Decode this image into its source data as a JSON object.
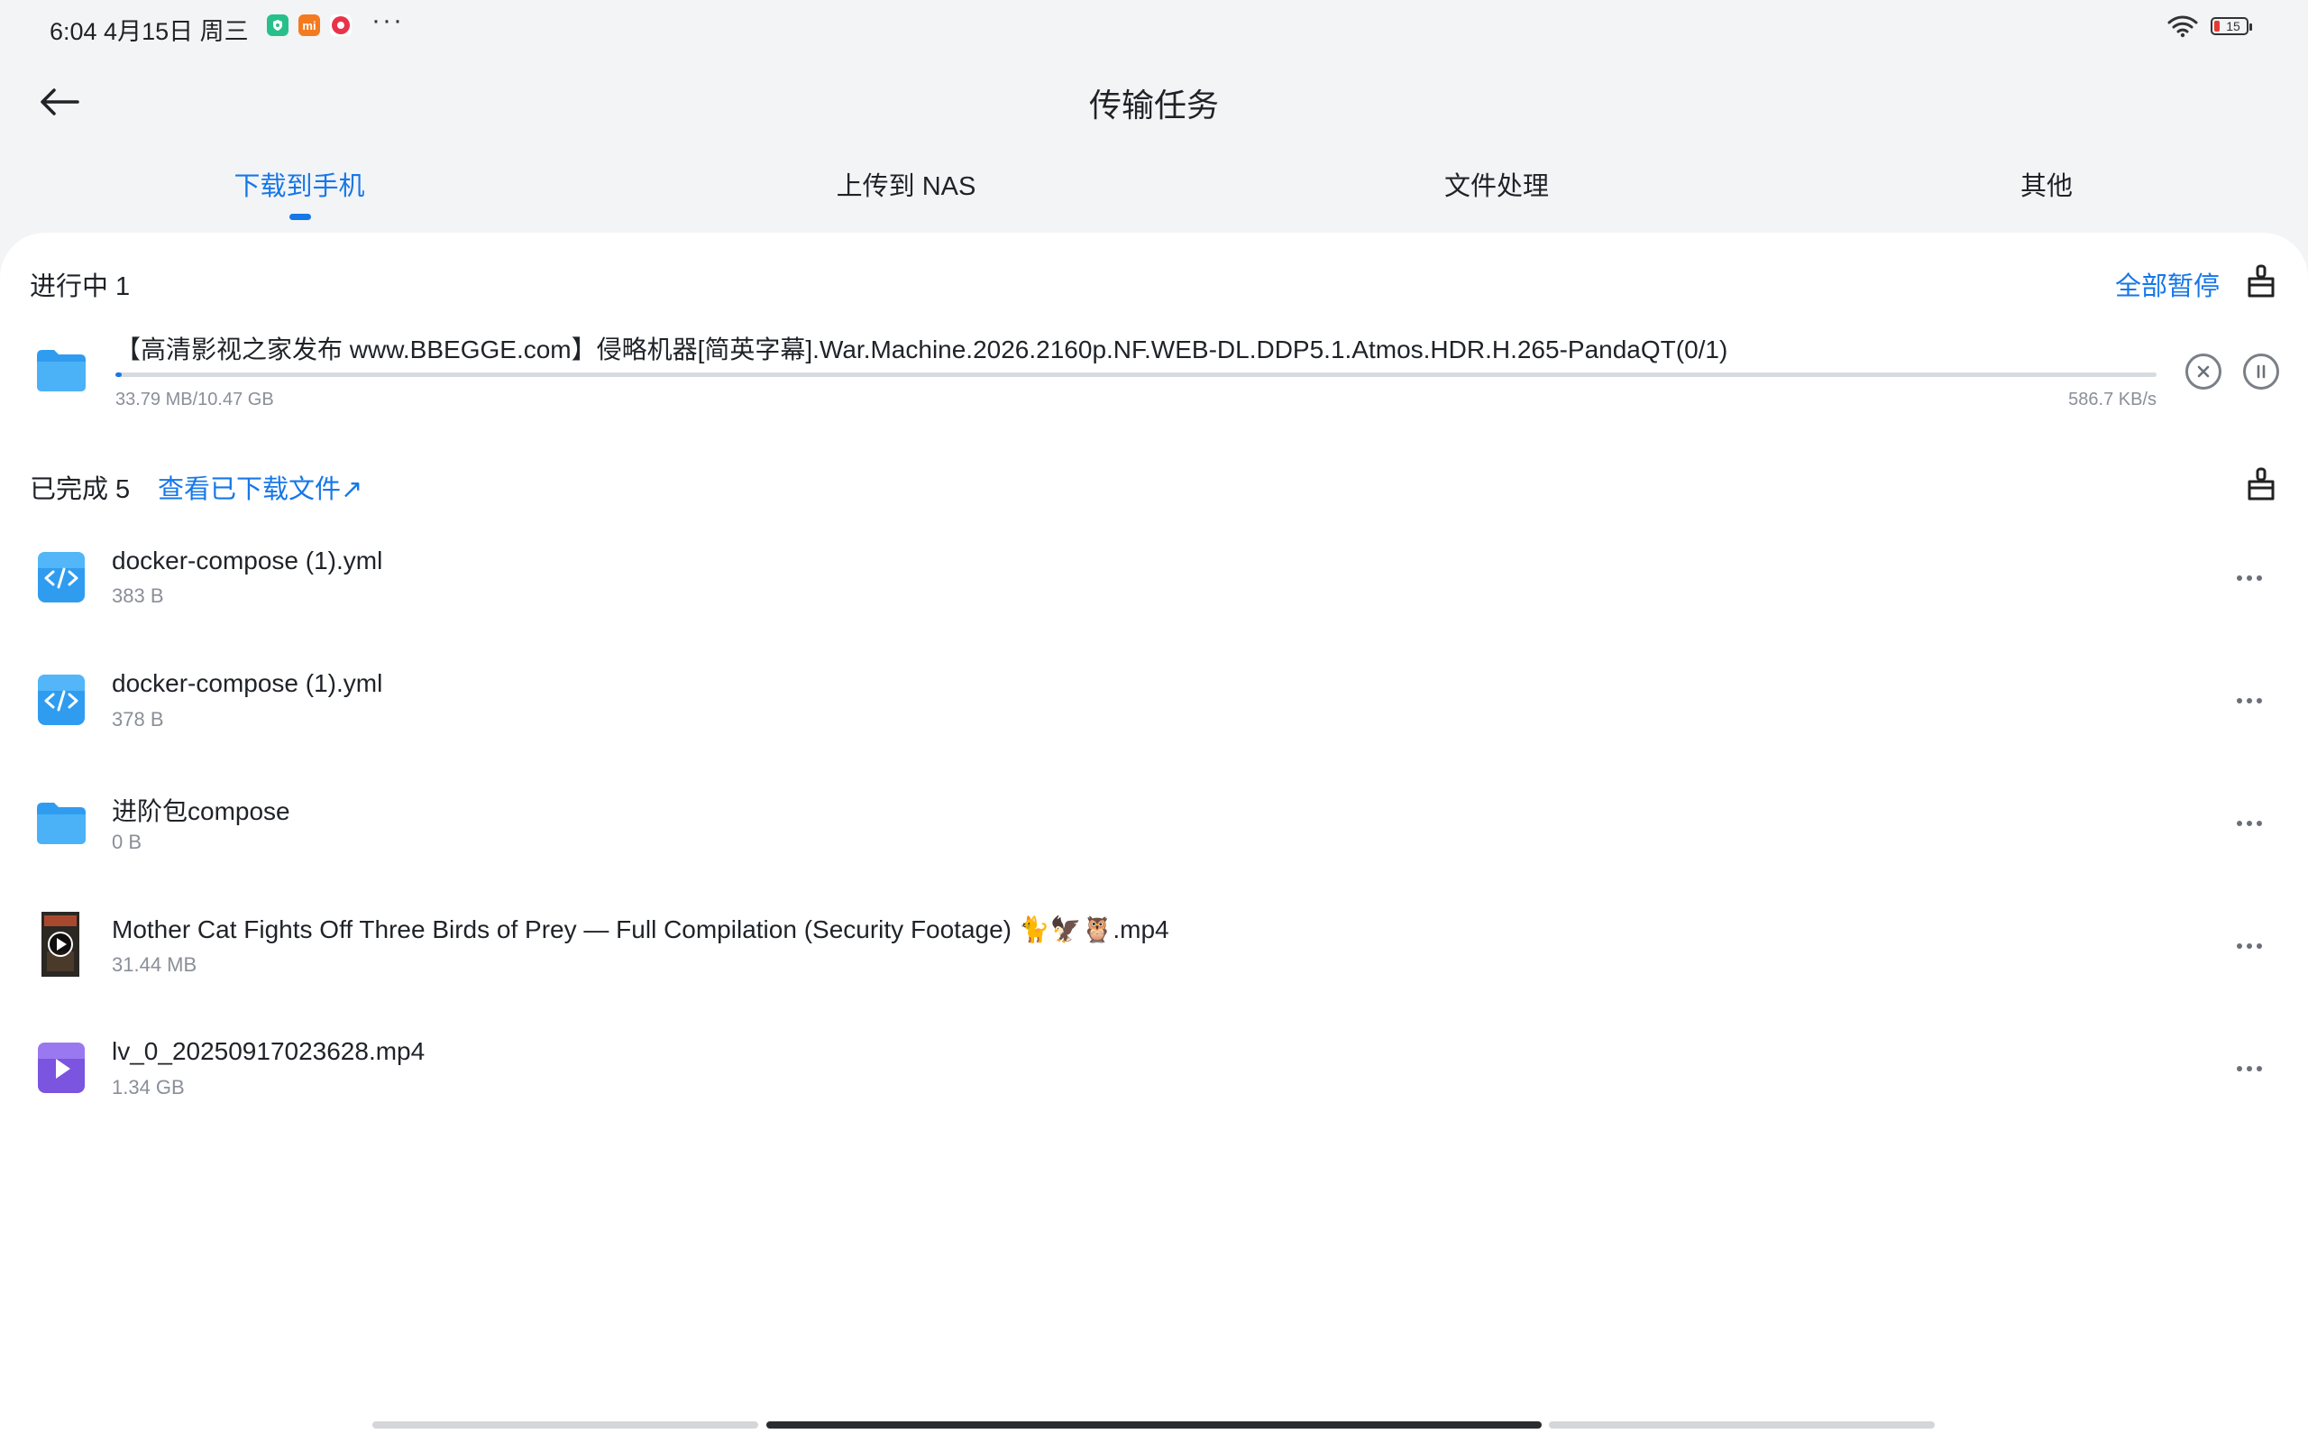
{
  "status_bar": {
    "time": "6:04 4月15日 周三",
    "more": "···",
    "battery": "15",
    "icons": [
      "shield-app-icon",
      "mi-app-icon",
      "recorder-app-icon",
      "wifi-icon",
      "battery-icon"
    ]
  },
  "header": {
    "title": "传输任务"
  },
  "tabs": [
    {
      "label": "下载到手机",
      "active": true
    },
    {
      "label": "上传到 NAS"
    },
    {
      "label": "文件处理"
    },
    {
      "label": "其他"
    }
  ],
  "in_progress": {
    "title": "进行中 1",
    "pause_all": "全部暂停",
    "task": {
      "name": "【高清影视之家发布 www.BBEGGE.com】侵略机器[简英字幕].War.Machine.2026.2160p.NF.WEB-DL.DDP5.1.Atmos.HDR.H.265-PandaQT(0/1)",
      "progress_text": "33.79 MB/10.47 GB",
      "speed": "586.7 KB/s",
      "progress_fraction": 0.003
    }
  },
  "completed": {
    "title": "已完成 5",
    "view_link": "查看已下载文件↗",
    "items": [
      {
        "name": "docker-compose (1).yml",
        "size": "383 B",
        "icon": "code-file-icon"
      },
      {
        "name": "docker-compose (1).yml",
        "size": "378 B",
        "icon": "code-file-icon"
      },
      {
        "name": "进阶包compose",
        "size": "0 B",
        "icon": "folder-icon"
      },
      {
        "name": "Mother Cat Fights Off Three Birds of Prey — Full Compilation (Security Footage) 🐈🦅🦉.mp4",
        "size": "31.44 MB",
        "icon": "video-thumbnail-icon"
      },
      {
        "name": "lv_0_20250917023628.mp4",
        "size": "1.34 GB",
        "icon": "video-file-icon"
      }
    ]
  },
  "colors": {
    "accent": "#1677e8",
    "background": "#f3f4f6",
    "card": "#ffffff"
  }
}
